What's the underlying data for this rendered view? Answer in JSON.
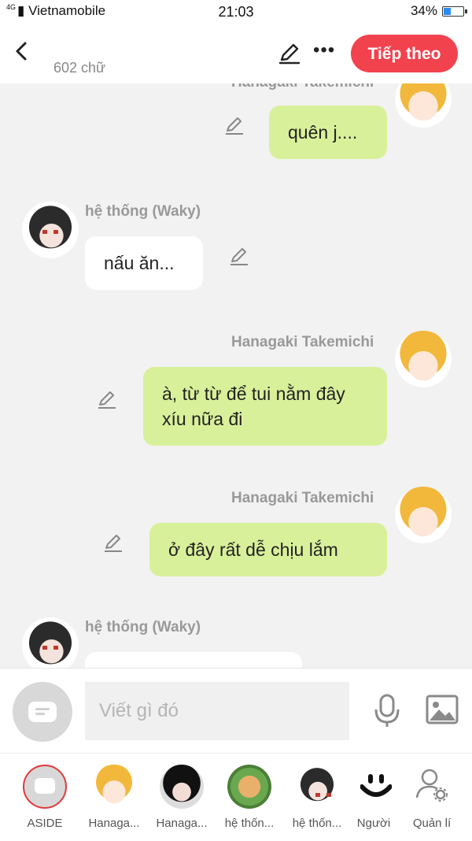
{
  "status": {
    "network": "4G",
    "carrier": "Vietnamobile",
    "time": "21:03",
    "battery": "34%",
    "battery_level": 0.34
  },
  "topbar": {
    "word_count": "602 chữ",
    "next_label": "Tiếp theo"
  },
  "messages": [
    {
      "sender": "Hanagaki Takemichi",
      "text": "quên j...."
    },
    {
      "sender": "hệ thống (Waky)",
      "text": "nấu ăn..."
    },
    {
      "sender": "Hanagaki Takemichi",
      "text": "à, từ từ để tui nằm đây xíu nữa đi"
    },
    {
      "sender": "Hanagaki Takemichi",
      "text": "ở đây rất dễ chịu lắm"
    },
    {
      "sender": "hệ thống (Waky)",
      "text": ""
    }
  ],
  "input": {
    "placeholder": "Viết gì đó"
  },
  "tabs": [
    {
      "label": "ASIDE"
    },
    {
      "label": "Hanaga..."
    },
    {
      "label": "Hanaga..."
    },
    {
      "label": "hệ thốn..."
    },
    {
      "label": "hệ thốn..."
    },
    {
      "label": "Người"
    },
    {
      "label": "Quản lí"
    }
  ],
  "colors": {
    "accent": "#f2424e",
    "bubble_green": "#d9f09a"
  },
  "icons": [
    "back-icon",
    "pencil-icon",
    "more-icon",
    "aside-icon",
    "microphone-icon",
    "image-icon",
    "manage-user-icon"
  ]
}
